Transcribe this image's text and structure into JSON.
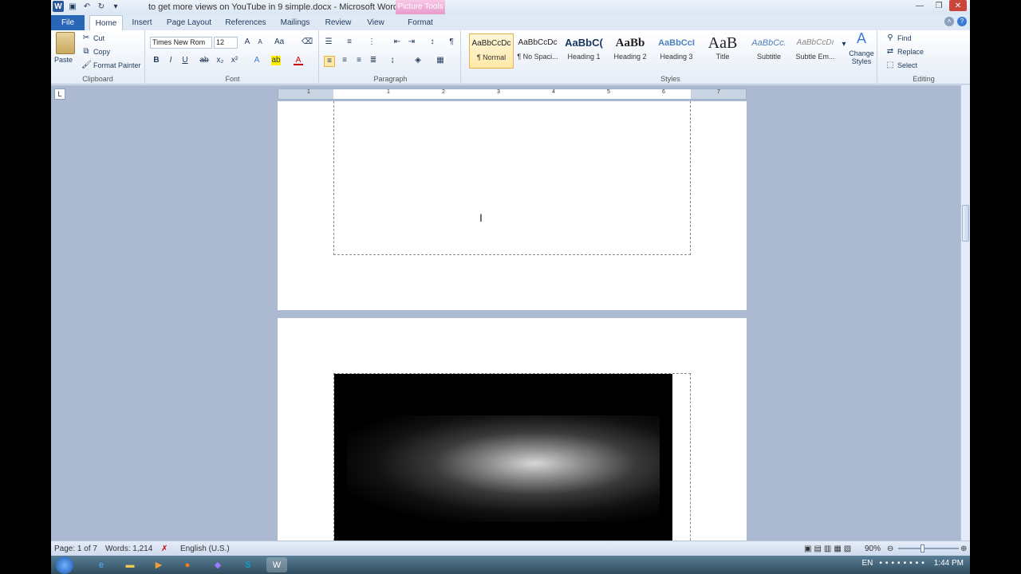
{
  "window": {
    "title": "to get more views on YouTube in 9 simple.docx - Microsoft Word",
    "contextual_tab_group": "Picture Tools"
  },
  "tabs": [
    "File",
    "Home",
    "Insert",
    "Page Layout",
    "References",
    "Mailings",
    "Review",
    "View",
    "Format"
  ],
  "clipboard": {
    "paste": "Paste",
    "cut": "Cut",
    "copy": "Copy",
    "format_painter": "Format Painter",
    "label": "Clipboard"
  },
  "font": {
    "name": "Times New Rom",
    "size": "12",
    "label": "Font"
  },
  "paragraph": {
    "label": "Paragraph"
  },
  "styles": {
    "label": "Styles",
    "items": [
      {
        "preview": "AaBbCcDc",
        "name": "¶ Normal"
      },
      {
        "preview": "AaBbCcDc",
        "name": "¶ No Spaci..."
      },
      {
        "preview": "AaBbC(",
        "name": "Heading 1"
      },
      {
        "preview": "AaBb",
        "name": "Heading 2"
      },
      {
        "preview": "AaBbCcI",
        "name": "Heading 3"
      },
      {
        "preview": "AaB",
        "name": "Title"
      },
      {
        "preview": "AaBbCc.",
        "name": "Subtitle"
      },
      {
        "preview": "AaBbCcDı",
        "name": "Subtle Em..."
      }
    ],
    "change_styles": "Change Styles"
  },
  "editing": {
    "find": "Find",
    "replace": "Replace",
    "select": "Select",
    "label": "Editing"
  },
  "ruler": {
    "corner": "L",
    "numbers": [
      "1",
      "1",
      "2",
      "3",
      "4",
      "5",
      "6",
      "7"
    ]
  },
  "statusbar": {
    "page": "Page: 1 of 7",
    "words": "Words: 1,214",
    "language": "English (U.S.)",
    "zoom": "90%"
  },
  "taskbar": {
    "language": "EN",
    "time": "1:44 PM"
  }
}
